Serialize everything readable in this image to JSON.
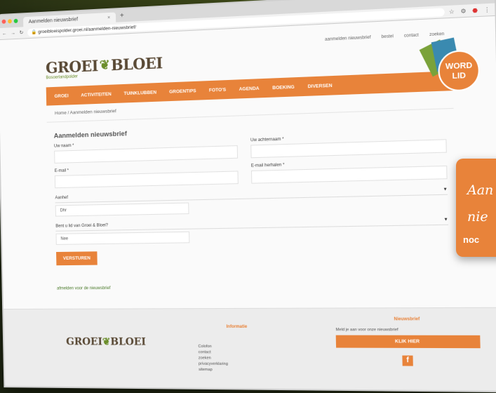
{
  "browser": {
    "tab_title": "Aanmelden nieuwsbrief",
    "url": "groeibloeispolder.groei.nl/aanmelden-nieuwsbrief/",
    "new_tab": "+",
    "close": "×"
  },
  "header": {
    "toplinks": [
      "aanmelden nieuwsbrief",
      "bestel",
      "contact",
      "zoeken"
    ],
    "logo_left": "GROEI",
    "logo_right": "BLOEI",
    "tagline": "Bosoerlandpolder"
  },
  "nav": {
    "items": [
      "GROEI",
      "ACTIVITEITEN",
      "TUINKLUBBEN",
      "GROENTIPS",
      "FOTO'S",
      "AGENDA",
      "BOEKING",
      "DIVERSEN"
    ],
    "badge_line1": "WORD",
    "badge_line2": "LID"
  },
  "breadcrumb": "Home / Aanmelden nieuwsbrief",
  "form": {
    "title": "Aanmelden nieuwsbrief",
    "first_name_label": "Uw naam *",
    "last_name_label": "Uw achternaam *",
    "email_label": "E-mail *",
    "email_repeat_label": "E-mail herhalen *",
    "salutation_label": "Aanhef",
    "salutation_value": "Dhr",
    "member_label": "Bent u lid van Groei & Bloei?",
    "member_value": "Nee",
    "submit_label": "VERSTUREN",
    "unsubscribe_link": "afmelden voor de nieuwsbrief"
  },
  "footer": {
    "logo_left": "GROEI",
    "logo_right": "BLOEI",
    "info_heading": "Informatie",
    "info_links": [
      "Colofon",
      "contact",
      "zoeken",
      "privacyverklaring",
      "sitemap"
    ],
    "newsletter_heading": "Nieuwsbrief",
    "newsletter_text": "Meld je aan voor onze nieuwsbrief",
    "newsletter_button": "KLIK HIER",
    "facebook": "f"
  },
  "callout": {
    "line1": "Aan",
    "line2": "nie",
    "line3": "noc"
  },
  "colors": {
    "accent": "#e8833a",
    "logo": "#5a4a36",
    "leaf": "#6b8e2b"
  }
}
